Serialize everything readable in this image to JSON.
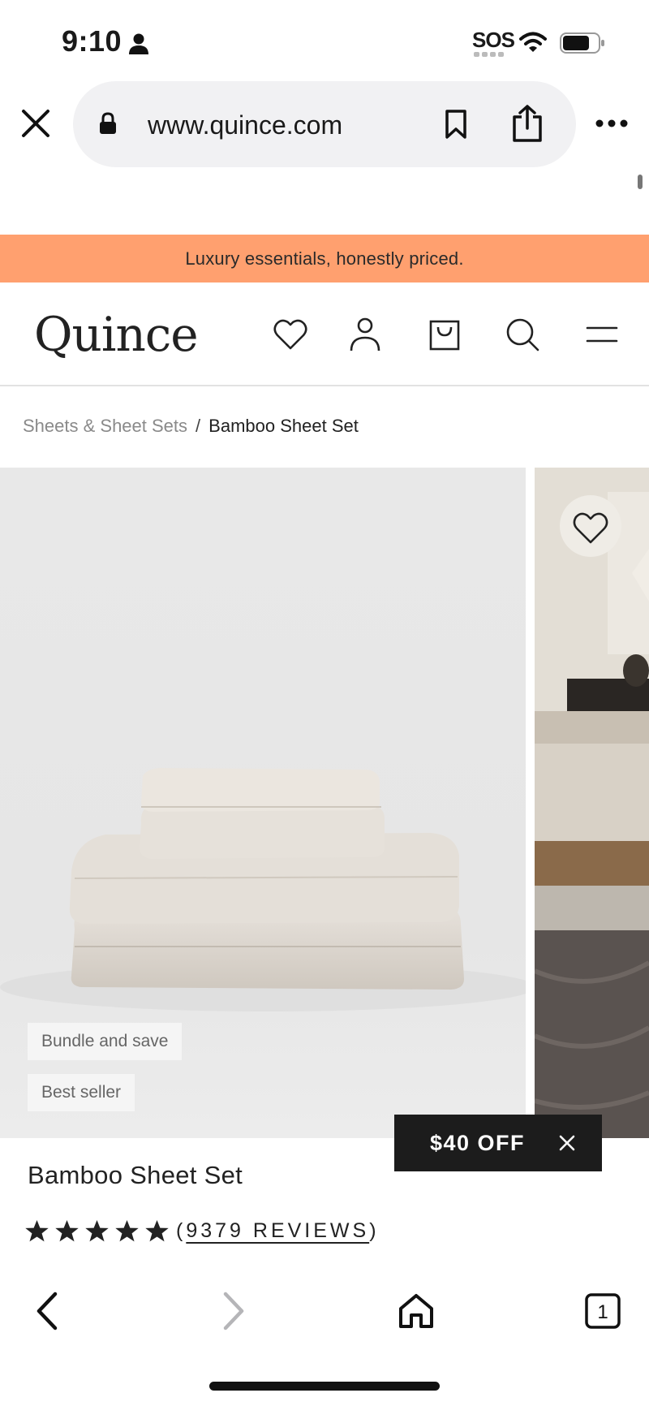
{
  "status_bar": {
    "time": "9:10",
    "sos": "SOS",
    "icons": [
      "person-icon",
      "wifi-icon",
      "battery-icon"
    ]
  },
  "browser": {
    "url": "www.quince.com",
    "icons": [
      "close-icon",
      "lock-icon",
      "bookmark-icon",
      "share-icon",
      "more-icon"
    ]
  },
  "announcement": "Luxury essentials, honestly priced.",
  "header": {
    "logo": "Quince",
    "icons": [
      "heart-icon",
      "account-icon",
      "bag-icon",
      "search-icon",
      "menu-icon"
    ]
  },
  "breadcrumb": {
    "parent": "Sheets & Sheet Sets",
    "separator": "/",
    "current": "Bamboo Sheet Set"
  },
  "gallery": {
    "tags": [
      "Bundle and save",
      "Best seller"
    ]
  },
  "product": {
    "title": "Bamboo Sheet Set",
    "rating_stars": 5,
    "reviews_open": "(",
    "reviews_text": "9379 REVIEWS",
    "reviews_close": ")"
  },
  "promo": {
    "label": "$40 OFF"
  },
  "toolbar": {
    "tab_count": "1",
    "icons": [
      "back-icon",
      "forward-icon",
      "home-icon",
      "tabs-icon"
    ]
  },
  "colors": {
    "announcement_bg": "#ffa06f",
    "promo_bg": "#1c1c1c"
  }
}
